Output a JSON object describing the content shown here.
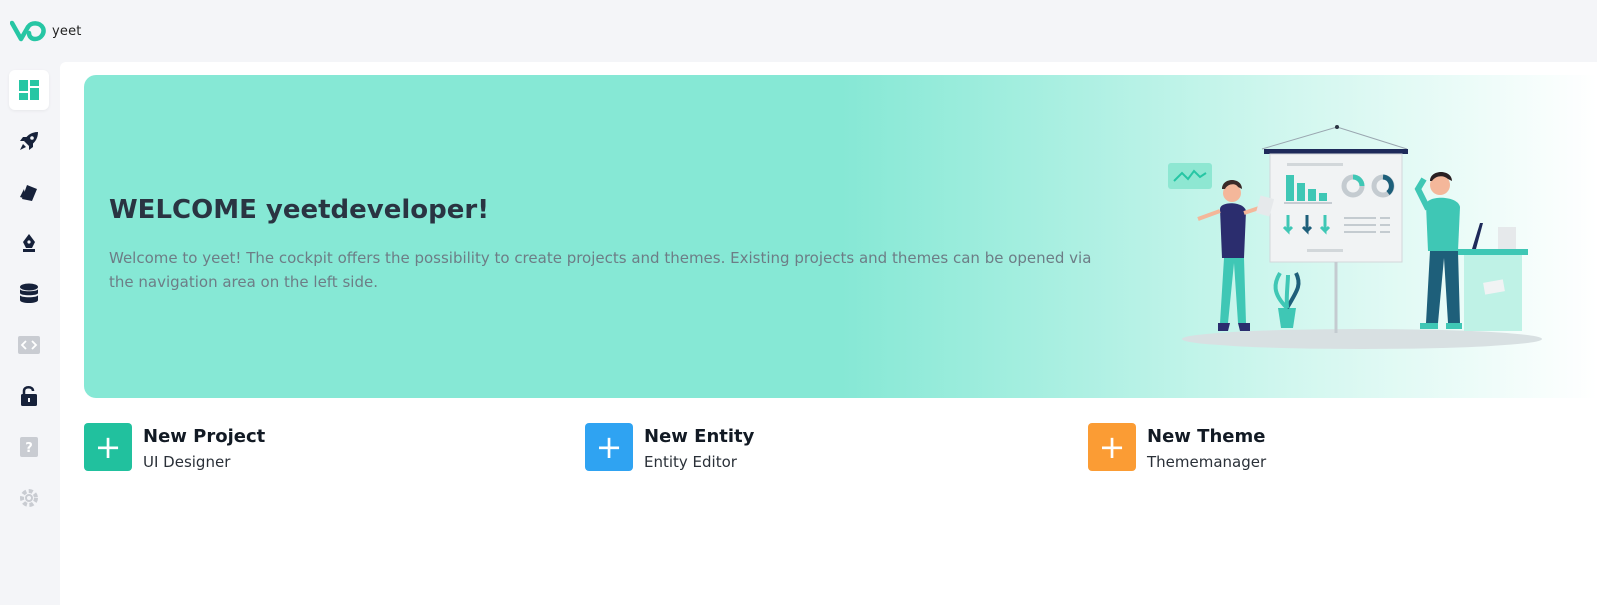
{
  "app": {
    "logo_text": "yeet",
    "accent": "#26c6a4"
  },
  "sidebar": {
    "items": [
      {
        "icon": "dashboard-icon",
        "active": true
      },
      {
        "icon": "rocket-icon",
        "active": false
      },
      {
        "icon": "theme-brush-icon",
        "active": false
      },
      {
        "icon": "pen-nib-icon",
        "active": false
      },
      {
        "icon": "database-icon",
        "active": false
      },
      {
        "icon": "code-icon",
        "active": false
      },
      {
        "icon": "lock-icon",
        "active": false
      },
      {
        "icon": "help-icon",
        "active": false
      },
      {
        "icon": "settings-gear-icon",
        "active": false
      }
    ]
  },
  "banner": {
    "title": "WELCOME yeetdeveloper!",
    "text": "Welcome to yeet! The cockpit offers the possibility to create projects and themes. Existing projects and themes can be opened via the navigation area on the left side."
  },
  "actions": [
    {
      "title": "New Project",
      "subtitle": "UI Designer",
      "color": "#21c19e"
    },
    {
      "title": "New Entity",
      "subtitle": "Entity Editor",
      "color": "#2fa3f2"
    },
    {
      "title": "New Theme",
      "subtitle": "Thememanager",
      "color": "#fb9c34"
    }
  ],
  "plus_symbol": "+"
}
